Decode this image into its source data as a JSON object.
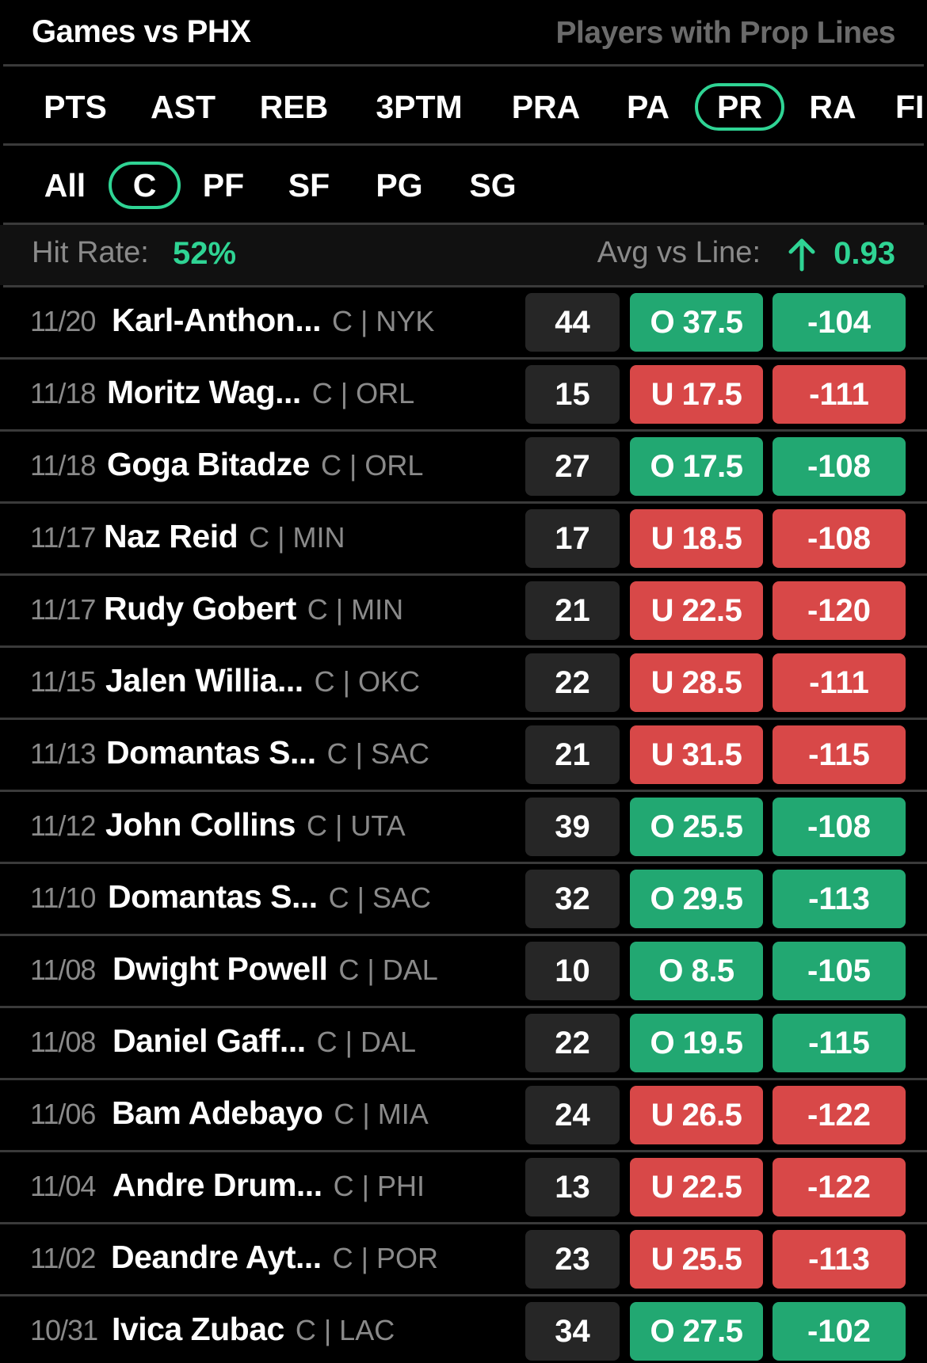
{
  "header": {
    "title": "Games vs PHX",
    "right_label": "Players with Prop Lines"
  },
  "stat_tabs": [
    {
      "label": "PTS",
      "active": false
    },
    {
      "label": "AST",
      "active": false
    },
    {
      "label": "REB",
      "active": false
    },
    {
      "label": "3PTM",
      "active": false
    },
    {
      "label": "PRA",
      "active": false
    },
    {
      "label": "PA",
      "active": false
    },
    {
      "label": "PR",
      "active": true
    },
    {
      "label": "RA",
      "active": false
    },
    {
      "label": "FI",
      "active": false
    }
  ],
  "position_tabs": [
    {
      "label": "All",
      "active": false
    },
    {
      "label": "C",
      "active": true
    },
    {
      "label": "PF",
      "active": false
    },
    {
      "label": "SF",
      "active": false
    },
    {
      "label": "PG",
      "active": false
    },
    {
      "label": "SG",
      "active": false
    }
  ],
  "summary": {
    "hit_rate_label": "Hit Rate:",
    "hit_rate_value": "52%",
    "avg_vs_line_label": "Avg vs Line:",
    "avg_vs_line_value": "0.93"
  },
  "colors": {
    "accent": "#2fd494",
    "over": "#22a872",
    "under": "#d84848"
  },
  "rows": [
    {
      "date": "11/20",
      "player": "Karl-Anthon...",
      "team": "C | NYK",
      "score": "44",
      "line": "O 37.5",
      "odds": "-104",
      "result": "over"
    },
    {
      "date": "11/18",
      "player": "Moritz Wag...",
      "team": "C | ORL",
      "score": "15",
      "line": "U 17.5",
      "odds": "-111",
      "result": "under"
    },
    {
      "date": "11/18",
      "player": "Goga Bitadze",
      "team": "C | ORL",
      "score": "27",
      "line": "O 17.5",
      "odds": "-108",
      "result": "over"
    },
    {
      "date": "11/17",
      "player": "Naz Reid",
      "team": "C | MIN",
      "score": "17",
      "line": "U 18.5",
      "odds": "-108",
      "result": "under"
    },
    {
      "date": "11/17",
      "player": "Rudy Gobert",
      "team": "C | MIN",
      "score": "21",
      "line": "U 22.5",
      "odds": "-120",
      "result": "under"
    },
    {
      "date": "11/15",
      "player": "Jalen Willia...",
      "team": "C | OKC",
      "score": "22",
      "line": "U 28.5",
      "odds": "-111",
      "result": "under"
    },
    {
      "date": "11/13",
      "player": "Domantas S...",
      "team": "C | SAC",
      "score": "21",
      "line": "U 31.5",
      "odds": "-115",
      "result": "under"
    },
    {
      "date": "11/12",
      "player": "John Collins",
      "team": "C | UTA",
      "score": "39",
      "line": "O 25.5",
      "odds": "-108",
      "result": "over"
    },
    {
      "date": "11/10",
      "player": "Domantas S...",
      "team": "C | SAC",
      "score": "32",
      "line": "O 29.5",
      "odds": "-113",
      "result": "over"
    },
    {
      "date": "11/08",
      "player": "Dwight Powell",
      "team": "C | DAL",
      "score": "10",
      "line": "O 8.5",
      "odds": "-105",
      "result": "over"
    },
    {
      "date": "11/08",
      "player": "Daniel Gaff...",
      "team": "C | DAL",
      "score": "22",
      "line": "O 19.5",
      "odds": "-115",
      "result": "over"
    },
    {
      "date": "11/06",
      "player": "Bam Adebayo",
      "team": "C | MIA",
      "score": "24",
      "line": "U 26.5",
      "odds": "-122",
      "result": "under"
    },
    {
      "date": "11/04",
      "player": "Andre Drum...",
      "team": "C | PHI",
      "score": "13",
      "line": "U 22.5",
      "odds": "-122",
      "result": "under"
    },
    {
      "date": "11/02",
      "player": "Deandre Ayt...",
      "team": "C | POR",
      "score": "23",
      "line": "U 25.5",
      "odds": "-113",
      "result": "under"
    },
    {
      "date": "10/31",
      "player": "Ivica Zubac",
      "team": "C | LAC",
      "score": "34",
      "line": "O 27.5",
      "odds": "-102",
      "result": "over"
    }
  ]
}
